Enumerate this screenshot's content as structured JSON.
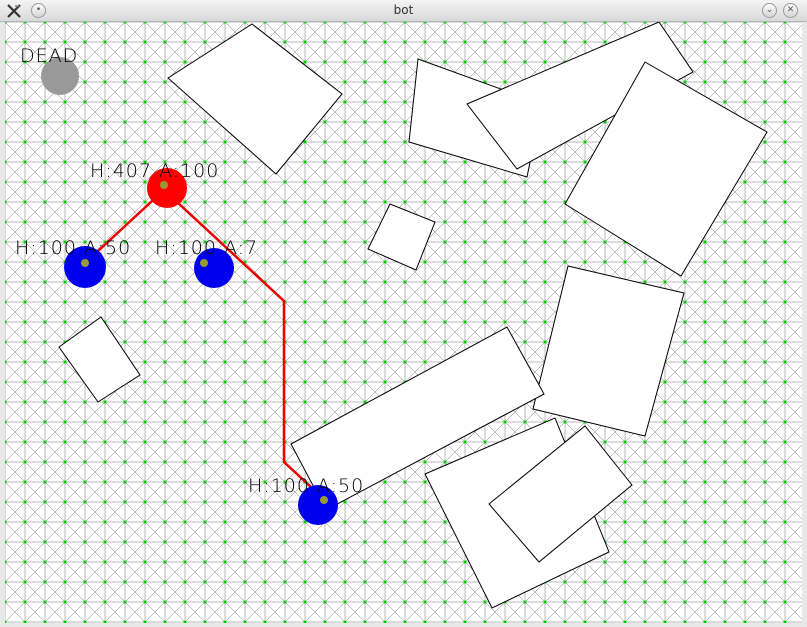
{
  "window": {
    "title": "bot"
  },
  "dead_label": "DEAD",
  "player": {
    "health_label": "H:407 A:100",
    "color": "#ff0000"
  },
  "enemies": [
    {
      "label": "H:100 A:50",
      "color": "#0000ee"
    },
    {
      "label": "H:100 A:7",
      "color": "#0000ee"
    },
    {
      "label": "H:100 A:50",
      "color": "#0000ee"
    }
  ],
  "dead_bot": {
    "color": "#999999"
  },
  "colors": {
    "nav_grid": "#00cc00",
    "grid_line": "#777777",
    "path": "#ee0000",
    "obstacle_border": "#000000"
  }
}
